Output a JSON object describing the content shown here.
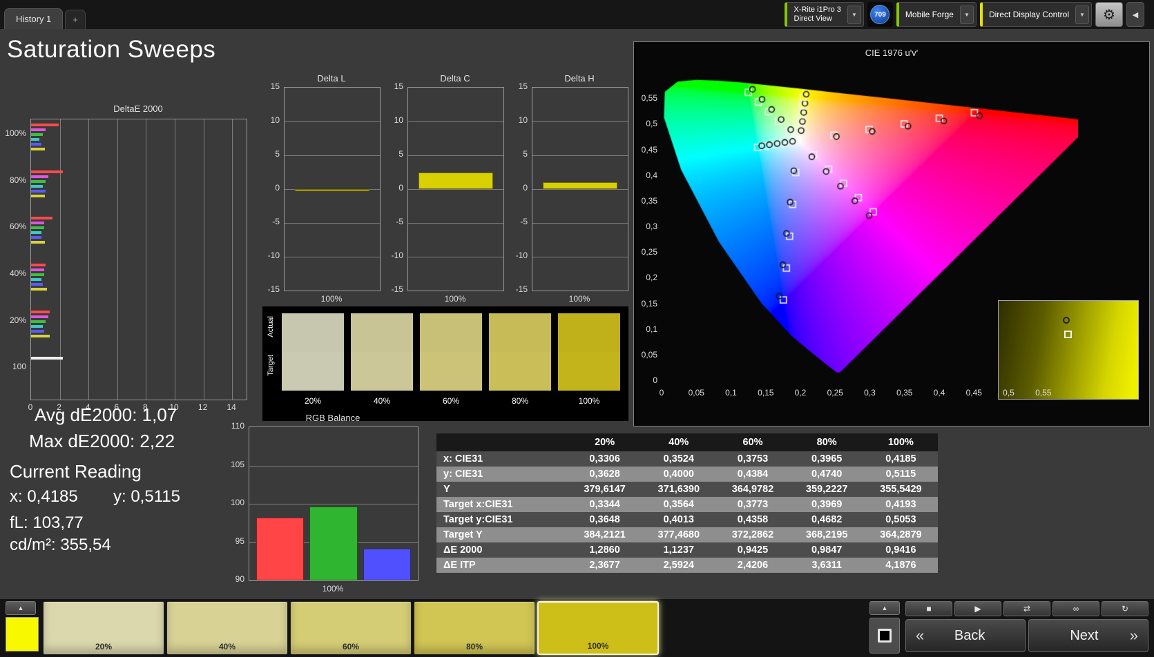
{
  "top_bar": {
    "tab": "History 1",
    "add_tab": "+",
    "meter": {
      "line1": "X-Rite i1Pro 3",
      "line2": "Direct View",
      "accent": "#86c400",
      "chevron": "▼"
    },
    "badge": "709",
    "source": {
      "label": "Mobile Forge",
      "accent": "#86c400",
      "chevron": "▼"
    },
    "display_control": {
      "label": "Direct Display Control",
      "accent": "#e6df00",
      "chevron": "▼"
    },
    "gear_icon": "⚙",
    "collapse_icon": "◀"
  },
  "page_title": "Saturation Sweeps",
  "readings": {
    "avg": "Avg dE2000: 1,07",
    "max": "Max dE2000: 2,22",
    "current_label": "Current Reading",
    "x": "x: 0,4185",
    "y": "y: 0,5115",
    "fl": "fL: 103,77",
    "cd": "cd/m²: 355,54"
  },
  "swatches": {
    "row_labels": [
      "Actual",
      "Target"
    ],
    "items": [
      {
        "label": "20%",
        "actual": "#c7c7b0",
        "target": "#cacab2"
      },
      {
        "label": "40%",
        "actual": "#c9c496",
        "target": "#ccc798"
      },
      {
        "label": "60%",
        "actual": "#c9c077",
        "target": "#ccc379"
      },
      {
        "label": "80%",
        "actual": "#c7bb57",
        "target": "#cabe59"
      },
      {
        "label": "100%",
        "actual": "#c0b11a",
        "target": "#c3b41c"
      }
    ]
  },
  "chart_data": [
    {
      "id": "deltae2000",
      "type": "bar",
      "orientation": "horizontal",
      "title": "DeltaE 2000",
      "xlim": [
        0,
        15
      ],
      "x_ticks": [
        0,
        2,
        4,
        6,
        8,
        10,
        12,
        14
      ],
      "groups": [
        {
          "label": "100%",
          "bars": [
            {
              "color": "#ff4a4a",
              "value": 1.9
            },
            {
              "color": "#e055e0",
              "value": 1.0
            },
            {
              "color": "#3fbf3f",
              "value": 0.8
            },
            {
              "color": "#3fc8c8",
              "value": 0.6
            },
            {
              "color": "#5a5aff",
              "value": 0.7
            },
            {
              "color": "#d8d23c",
              "value": 0.94
            }
          ]
        },
        {
          "label": "80%",
          "bars": [
            {
              "color": "#ff4a4a",
              "value": 2.2
            },
            {
              "color": "#e055e0",
              "value": 1.2
            },
            {
              "color": "#3fbf3f",
              "value": 1.0
            },
            {
              "color": "#3fc8c8",
              "value": 0.8
            },
            {
              "color": "#5a5aff",
              "value": 1.0
            },
            {
              "color": "#d8d23c",
              "value": 0.98
            }
          ]
        },
        {
          "label": "60%",
          "bars": [
            {
              "color": "#ff4a4a",
              "value": 1.5
            },
            {
              "color": "#e055e0",
              "value": 0.9
            },
            {
              "color": "#3fbf3f",
              "value": 0.9
            },
            {
              "color": "#3fc8c8",
              "value": 0.7
            },
            {
              "color": "#5a5aff",
              "value": 0.7
            },
            {
              "color": "#d8d23c",
              "value": 0.94
            }
          ]
        },
        {
          "label": "40%",
          "bars": [
            {
              "color": "#ff4a4a",
              "value": 1.0
            },
            {
              "color": "#e055e0",
              "value": 0.9
            },
            {
              "color": "#3fbf3f",
              "value": 0.9
            },
            {
              "color": "#3fc8c8",
              "value": 0.7
            },
            {
              "color": "#5a5aff",
              "value": 0.8
            },
            {
              "color": "#d8d23c",
              "value": 1.12
            }
          ]
        },
        {
          "label": "20%",
          "bars": [
            {
              "color": "#ff4a4a",
              "value": 1.3
            },
            {
              "color": "#e055e0",
              "value": 1.2
            },
            {
              "color": "#3fbf3f",
              "value": 1.0
            },
            {
              "color": "#3fc8c8",
              "value": 0.8
            },
            {
              "color": "#5a5aff",
              "value": 0.9
            },
            {
              "color": "#d8d23c",
              "value": 1.29
            }
          ]
        },
        {
          "label": "100",
          "bars": [
            {
              "color": "#f0f0f0",
              "value": 2.2
            }
          ]
        }
      ]
    },
    {
      "id": "delta_l",
      "type": "bar",
      "title": "Delta L",
      "ylim": [
        -15,
        15
      ],
      "y_ticks": [
        15,
        10,
        5,
        0,
        -5,
        -10,
        -15
      ],
      "x_label": "100%",
      "bars": [
        {
          "color": "#d8d000",
          "value": -0.3
        }
      ]
    },
    {
      "id": "delta_c",
      "type": "bar",
      "title": "Delta C",
      "ylim": [
        -15,
        15
      ],
      "y_ticks": [
        15,
        10,
        5,
        0,
        -5,
        -10,
        -15
      ],
      "x_label": "100%",
      "bars": [
        {
          "color": "#d8d000",
          "value": 2.4
        }
      ]
    },
    {
      "id": "delta_h",
      "type": "bar",
      "title": "Delta H",
      "ylim": [
        -15,
        15
      ],
      "y_ticks": [
        15,
        10,
        5,
        0,
        -5,
        -10,
        -15
      ],
      "x_label": "100%",
      "bars": [
        {
          "color": "#d8d000",
          "value": 1.0
        }
      ]
    },
    {
      "id": "rgb_balance",
      "type": "bar",
      "title": "RGB Balance",
      "ylim": [
        90,
        110
      ],
      "y_ticks": [
        110,
        105,
        100,
        95,
        90
      ],
      "x_label": "100%",
      "bars": [
        {
          "color": "#ff4545",
          "value": 98.2
        },
        {
          "color": "#2fb52f",
          "value": 99.6
        },
        {
          "color": "#5050ff",
          "value": 94.1
        }
      ]
    },
    {
      "id": "cie1976",
      "type": "scatter",
      "title": "CIE 1976 u'v'",
      "u_range": [
        0,
        0.6
      ],
      "v_range": [
        0,
        0.6
      ],
      "tick_labels": [
        "0",
        "0,05",
        "0,1",
        "0,15",
        "0,2",
        "0,25",
        "0,3",
        "0,35",
        "0,4",
        "0,45",
        "0,5",
        "0,55"
      ],
      "white_point": [
        0.1978,
        0.4683
      ],
      "levels": [
        0.2,
        0.4,
        0.6,
        0.8,
        1.0
      ],
      "sweeps": [
        {
          "name": "red",
          "target": [
            0.4507,
            0.5229
          ],
          "offset": [
            0.005,
            -0.004
          ]
        },
        {
          "name": "green",
          "target": [
            0.125,
            0.5625
          ],
          "offset": [
            0.004,
            0.004
          ]
        },
        {
          "name": "blue",
          "target": [
            0.1754,
            0.1579
          ],
          "offset": [
            -0.004,
            0.005
          ]
        },
        {
          "name": "cyan",
          "target": [
            0.1383,
            0.4554
          ],
          "offset": [
            0.004,
            0.002
          ]
        },
        {
          "name": "magenta",
          "target": [
            0.305,
            0.3297
          ],
          "offset": [
            -0.004,
            -0.005
          ]
        },
        {
          "name": "yellow",
          "target": [
            0.2039,
            0.5529
          ],
          "offset": [
            0.003,
            0.004
          ]
        }
      ],
      "locus_xy": [
        [
          0.1741,
          0.005
        ],
        [
          0.1714,
          0.0051
        ],
        [
          0.1644,
          0.0109
        ],
        [
          0.144,
          0.0297
        ],
        [
          0.1241,
          0.0578
        ],
        [
          0.0913,
          0.1327
        ],
        [
          0.0454,
          0.295
        ],
        [
          0.0082,
          0.5384
        ],
        [
          0.0139,
          0.7502
        ],
        [
          0.0743,
          0.8338
        ],
        [
          0.1547,
          0.8059
        ],
        [
          0.2296,
          0.7543
        ],
        [
          0.3016,
          0.6923
        ],
        [
          0.3731,
          0.6245
        ],
        [
          0.4441,
          0.5547
        ],
        [
          0.5125,
          0.4866
        ],
        [
          0.5752,
          0.4242
        ],
        [
          0.627,
          0.3725
        ],
        [
          0.6658,
          0.334
        ],
        [
          0.6915,
          0.3083
        ],
        [
          0.7079,
          0.292
        ],
        [
          0.726,
          0.274
        ],
        [
          0.7347,
          0.2653
        ]
      ],
      "inset": {
        "square": [
          0.47,
          0.3
        ],
        "circle": [
          0.46,
          0.16
        ]
      }
    }
  ],
  "table": {
    "header": [
      "",
      "20%",
      "40%",
      "60%",
      "80%",
      "100%"
    ],
    "rows": [
      {
        "label": "x: CIE31",
        "values": [
          "0,3306",
          "0,3524",
          "0,3753",
          "0,3965",
          "0,4185"
        ]
      },
      {
        "label": "y: CIE31",
        "values": [
          "0,3628",
          "0,4000",
          "0,4384",
          "0,4740",
          "0,5115"
        ]
      },
      {
        "label": "Y",
        "values": [
          "379,6147",
          "371,6390",
          "364,9782",
          "359,2227",
          "355,5429"
        ]
      },
      {
        "label": "Target x:CIE31",
        "values": [
          "0,3344",
          "0,3564",
          "0,3773",
          "0,3969",
          "0,4193"
        ]
      },
      {
        "label": "Target y:CIE31",
        "values": [
          "0,3648",
          "0,4013",
          "0,4358",
          "0,4682",
          "0,5053"
        ]
      },
      {
        "label": "Target Y",
        "values": [
          "384,2121",
          "377,4680",
          "372,2862",
          "368,2195",
          "364,2879"
        ]
      },
      {
        "label": "ΔE 2000",
        "values": [
          "1,2860",
          "1,1237",
          "0,9425",
          "0,9847",
          "0,9416"
        ]
      },
      {
        "label": "ΔE ITP",
        "values": [
          "2,3677",
          "2,5924",
          "2,4206",
          "3,6311",
          "4,1876"
        ]
      }
    ]
  },
  "bottom_bar": {
    "up_arrow": "▲",
    "current_color": "#f8f800",
    "level_buttons": [
      {
        "label": "20%",
        "color": "#dbd8ae",
        "selected": false
      },
      {
        "label": "40%",
        "color": "#d8d295",
        "selected": false
      },
      {
        "label": "60%",
        "color": "#d5cd75",
        "selected": false
      },
      {
        "label": "80%",
        "color": "#d1c554",
        "selected": false
      },
      {
        "label": "100%",
        "color": "#cdbf18",
        "selected": true
      }
    ],
    "icons": [
      {
        "name": "stop",
        "glyph": "■"
      },
      {
        "name": "play",
        "glyph": "▶"
      },
      {
        "name": "step",
        "glyph": "⇄"
      },
      {
        "name": "continuous",
        "glyph": "∞"
      },
      {
        "name": "refresh",
        "glyph": "↻"
      }
    ],
    "back_chevron": "«",
    "back_label": "Back",
    "next_label": "Next",
    "next_chevron": "»"
  }
}
